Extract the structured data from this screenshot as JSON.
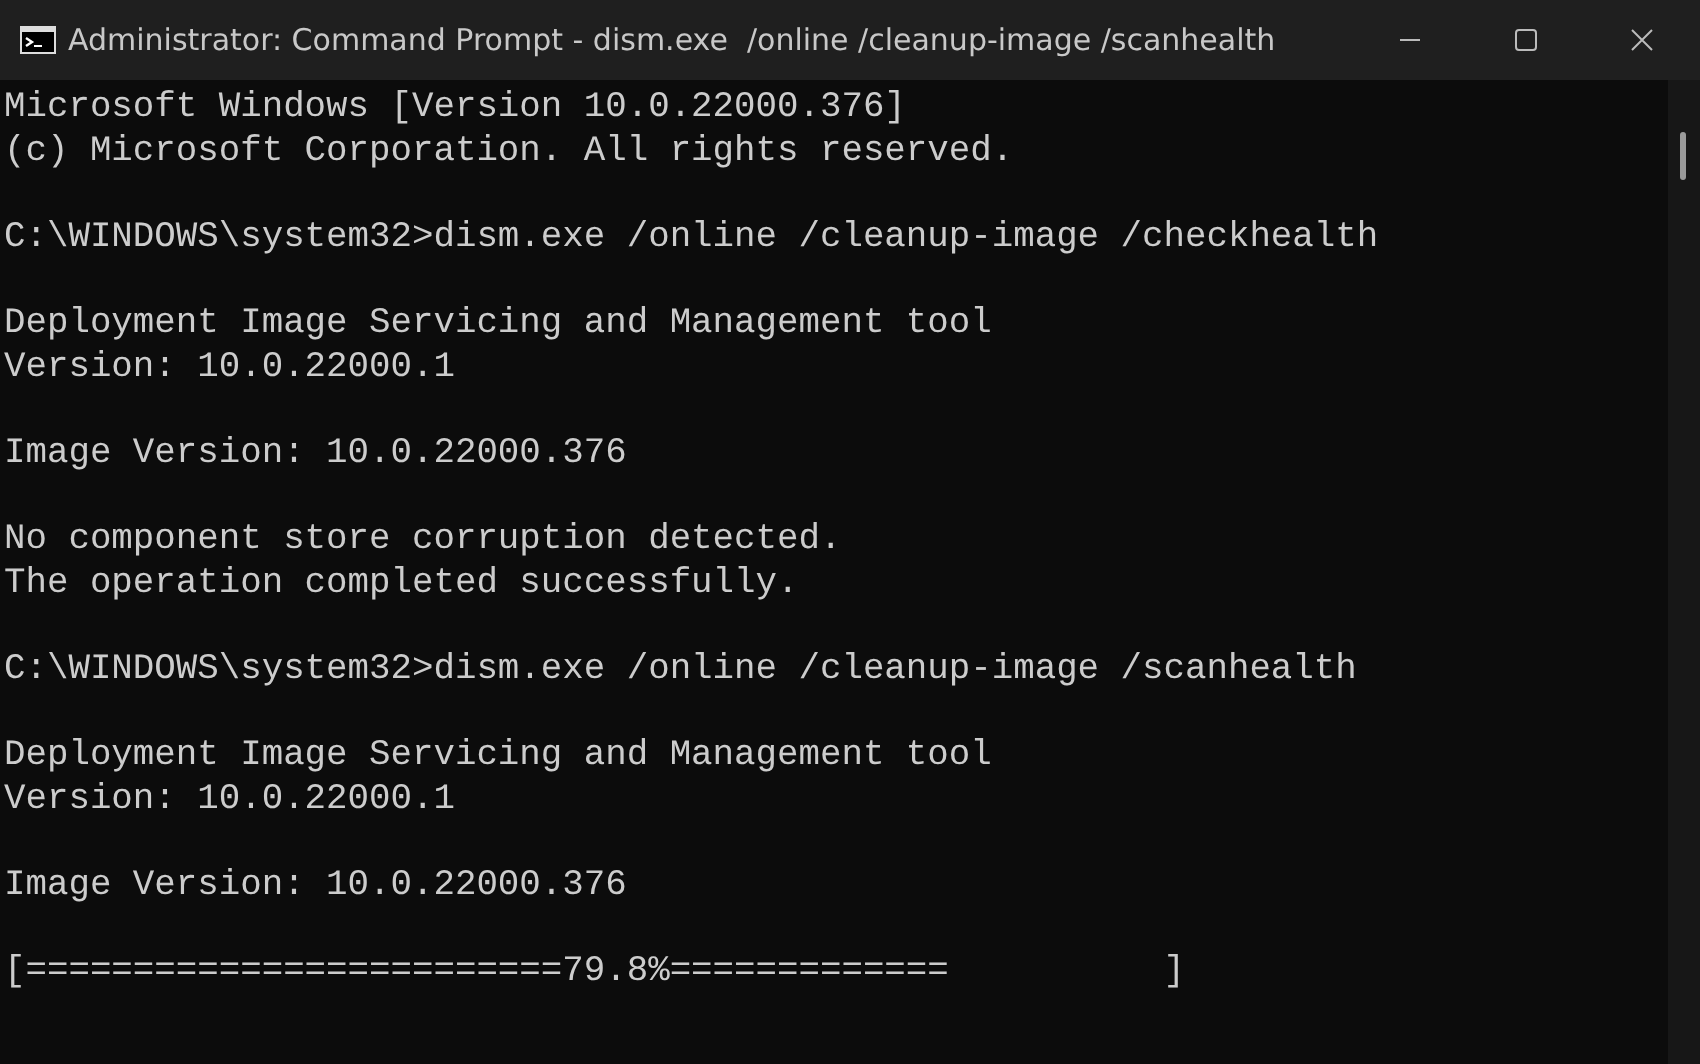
{
  "window": {
    "title": "Administrator: Command Prompt - dism.exe  /online /cleanup-image /scanhealth"
  },
  "console": {
    "blocks": [
      [
        "Microsoft Windows [Version 10.0.22000.376]",
        "(c) Microsoft Corporation. All rights reserved."
      ],
      [
        "C:\\WINDOWS\\system32>dism.exe /online /cleanup-image /checkhealth"
      ],
      [
        "Deployment Image Servicing and Management tool",
        "Version: 10.0.22000.1"
      ],
      [
        "Image Version: 10.0.22000.376"
      ],
      [
        "No component store corruption detected.",
        "The operation completed successfully."
      ],
      [
        "C:\\WINDOWS\\system32>dism.exe /online /cleanup-image /scanhealth"
      ],
      [
        "Deployment Image Servicing and Management tool",
        "Version: 10.0.22000.1"
      ],
      [
        "Image Version: 10.0.22000.376"
      ],
      [
        "[=========================79.8%=============          ]"
      ]
    ]
  }
}
